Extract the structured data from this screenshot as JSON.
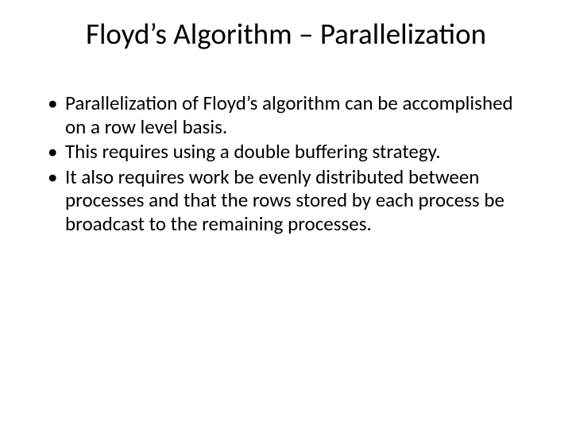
{
  "title": "Floyd’s Algorithm – Parallelization",
  "bullets": [
    "Parallelization of Floyd’s algorithm can be accomplished on a row level basis.",
    "This requires using a double buffering strategy.",
    "It also requires work be evenly distributed between processes and that the rows stored by each process be broadcast to the remaining processes."
  ]
}
